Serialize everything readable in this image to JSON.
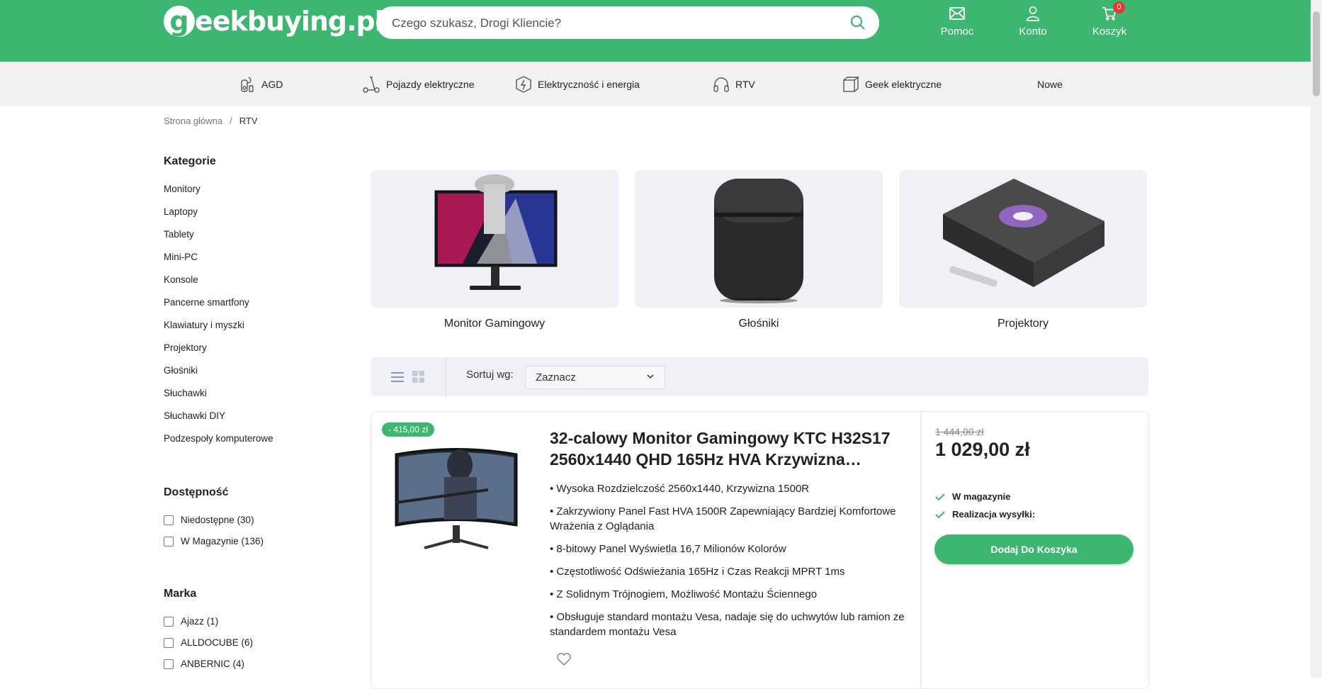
{
  "header": {
    "logo_g": "g",
    "logo_text": "eekbuying.pl",
    "search_placeholder": "Czego szukasz, Drogi Kliencie?",
    "actions": {
      "help": "Pomoc",
      "account": "Konto",
      "cart": "Koszyk",
      "cart_count": "0"
    },
    "brand_color": "#3db672"
  },
  "category_nav": [
    {
      "label": "AGD",
      "icon": "appliance-icon"
    },
    {
      "label": "Pojazdy elektryczne",
      "icon": "scooter-icon"
    },
    {
      "label": "Elektryczność i energia",
      "icon": "lightning-icon"
    },
    {
      "label": "RTV",
      "icon": "headphones-icon"
    },
    {
      "label": "Geek elektryczne",
      "icon": "cube-icon"
    },
    {
      "label": "Nowe",
      "icon": ""
    }
  ],
  "breadcrumb": {
    "home": "Strona główna",
    "separator": "/",
    "current": "RTV"
  },
  "sidebar": {
    "categories_title": "Kategorie",
    "categories": [
      "Monitory",
      "Laptopy",
      "Tablety",
      "Mini-PC",
      "Konsole",
      "Pancerne smartfony",
      "Klawiatury i myszki",
      "Projektory",
      "Głośniki",
      "Słuchawki",
      "Słuchawki DIY",
      "Podzespoły komputerowe"
    ],
    "availability_title": "Dostępność",
    "availability": [
      "Niedostępne (30)",
      "W Magazynie (136)"
    ],
    "brand_title": "Marka",
    "brands": [
      "Ajazz (1)",
      "ALLDOCUBE (6)",
      "ANBERNIC (4)"
    ]
  },
  "category_cards": [
    {
      "label": "Monitor Gamingowy"
    },
    {
      "label": "Głośniki"
    },
    {
      "label": "Projektory"
    }
  ],
  "toolbar": {
    "sort_label": "Sortuj wg:",
    "sort_value": "Zaznacz"
  },
  "product": {
    "discount": "- 415,00 zł",
    "title": "32-calowy Monitor Gamingowy KTC H32S17 2560x1440 QHD 165Hz HVA Krzywizna…",
    "bullets": [
      "• Wysoka Rozdzielczość 2560x1440, Krzywizna 1500R",
      "• Zakrzywiony Panel Fast HVA 1500R Zapewniający Bardziej Komfortowe Wrażenia z Oglądania",
      "• 8-bitowy Panel Wyświetla 16,7 Milionów Kolorów",
      "• Częstotliwość Odświeżania 165Hz i Czas Reakcji MPRT 1ms",
      "• Z Solidnym Trójnogiem, Możliwość Montażu Ściennego",
      "• Obsługuje standard montażu Vesa, nadaje się do uchwytów lub ramion ze standardem montażu Vesa"
    ],
    "old_price": "1 444,00 zł",
    "price": "1 029,00 zł",
    "stock": "W magazynie",
    "shipping": "Realizacja wysyłki:",
    "add_to_cart": "Dodaj Do Koszyka"
  }
}
